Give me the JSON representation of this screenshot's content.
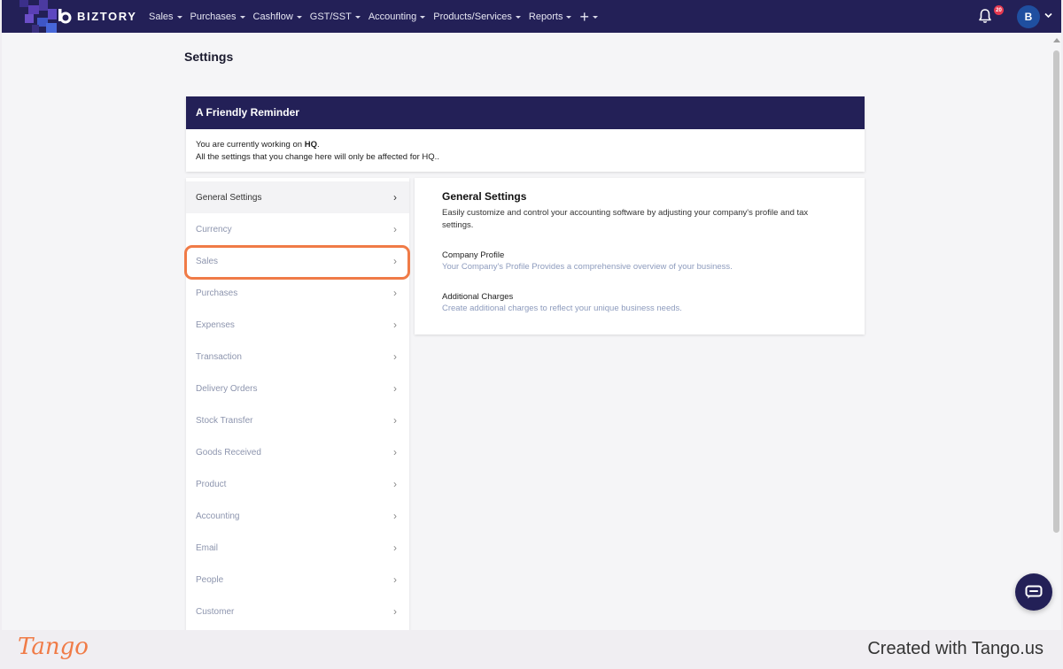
{
  "nav": {
    "brand": "BIZTORY",
    "menu": [
      {
        "label": "Sales"
      },
      {
        "label": "Purchases"
      },
      {
        "label": "Cashflow"
      },
      {
        "label": "GST/SST"
      },
      {
        "label": "Accounting"
      },
      {
        "label": "Products/Services"
      },
      {
        "label": "Reports"
      }
    ],
    "plus": "+",
    "notifications_count": "20",
    "avatar_initial": "B",
    "bg_color": "#232057"
  },
  "page": {
    "title": "Settings"
  },
  "reminder": {
    "title": "A Friendly Reminder",
    "line1_prefix": "You are currently working on ",
    "branch": "HQ",
    "line1_suffix": ".",
    "line2": "All the settings that you change here will only be affected for HQ.."
  },
  "side_menu": {
    "items": [
      {
        "label": "General Settings",
        "active": true
      },
      {
        "label": "Currency"
      },
      {
        "label": "Sales",
        "highlighted": true
      },
      {
        "label": "Purchases"
      },
      {
        "label": "Expenses"
      },
      {
        "label": "Transaction"
      },
      {
        "label": "Delivery Orders"
      },
      {
        "label": "Stock Transfer"
      },
      {
        "label": "Goods Received"
      },
      {
        "label": "Product"
      },
      {
        "label": "Accounting"
      },
      {
        "label": "Email"
      },
      {
        "label": "People"
      },
      {
        "label": "Customer"
      }
    ],
    "chevron": "›",
    "highlight_color": "#f07b47"
  },
  "panel": {
    "title": "General Settings",
    "description": "Easily customize and control your accounting software by adjusting your company's profile and tax settings.",
    "links": [
      {
        "title": "Company Profile",
        "description": "Your Company's Profile Provides a comprehensive overview of your business."
      },
      {
        "title": "Additional Charges",
        "description": "Create additional charges to reflect your unique business needs."
      }
    ]
  },
  "footer": {
    "logo": "Tango",
    "created_with": "Created with Tango.us"
  }
}
